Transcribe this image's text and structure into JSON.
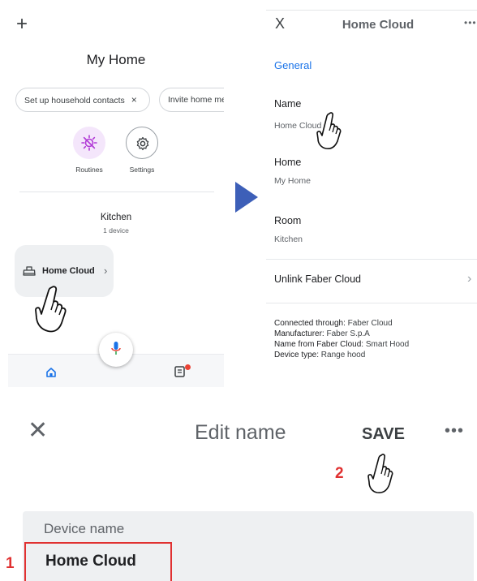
{
  "left_panel": {
    "add_icon": "+",
    "title": "My Home",
    "chips": [
      "Set up household contacts",
      "Invite home me"
    ],
    "chip_close": "×",
    "actions": [
      {
        "label": "Routines",
        "icon": "routines-icon",
        "color": "#b13ad6"
      },
      {
        "label": "Settings",
        "icon": "gear-icon"
      }
    ],
    "room_name": "Kitchen",
    "room_count": "1 device",
    "device_name": "Home Cloud",
    "device_chevron": "›",
    "nav": [
      {
        "icon": "home-icon",
        "active": true
      },
      {
        "icon": "feed-icon",
        "badge": true
      }
    ],
    "mic_icon": "mic-icon"
  },
  "right_panel": {
    "close": "X",
    "title": "Home Cloud",
    "more": "•••",
    "section": "General",
    "fields": [
      {
        "label": "Name",
        "value": "Home Cloud"
      },
      {
        "label": "Home",
        "value": "My Home"
      },
      {
        "label": "Room",
        "value": "Kitchen"
      }
    ],
    "unlink": "Unlink Faber Cloud",
    "unlink_chevron": "›",
    "info": [
      {
        "key": "Connected through:",
        "value": " Faber Cloud"
      },
      {
        "key": "Manufacturer:",
        "value": " Faber S.p.A"
      },
      {
        "key": "Name from Faber Cloud:",
        "value": " Smart Hood"
      },
      {
        "key": "Device type:",
        "value": " Range hood"
      }
    ]
  },
  "bottom_panel": {
    "close": "✕",
    "title": "Edit name",
    "save": "SAVE",
    "more": "•••",
    "field_label": "Device name",
    "field_value": "Home Cloud",
    "step_1": "1",
    "step_2": "2"
  },
  "colors": {
    "accent": "#1a73e8",
    "arrow": "#3d5fb8",
    "highlight": "#e03131",
    "routines": "#f4e6fb"
  }
}
